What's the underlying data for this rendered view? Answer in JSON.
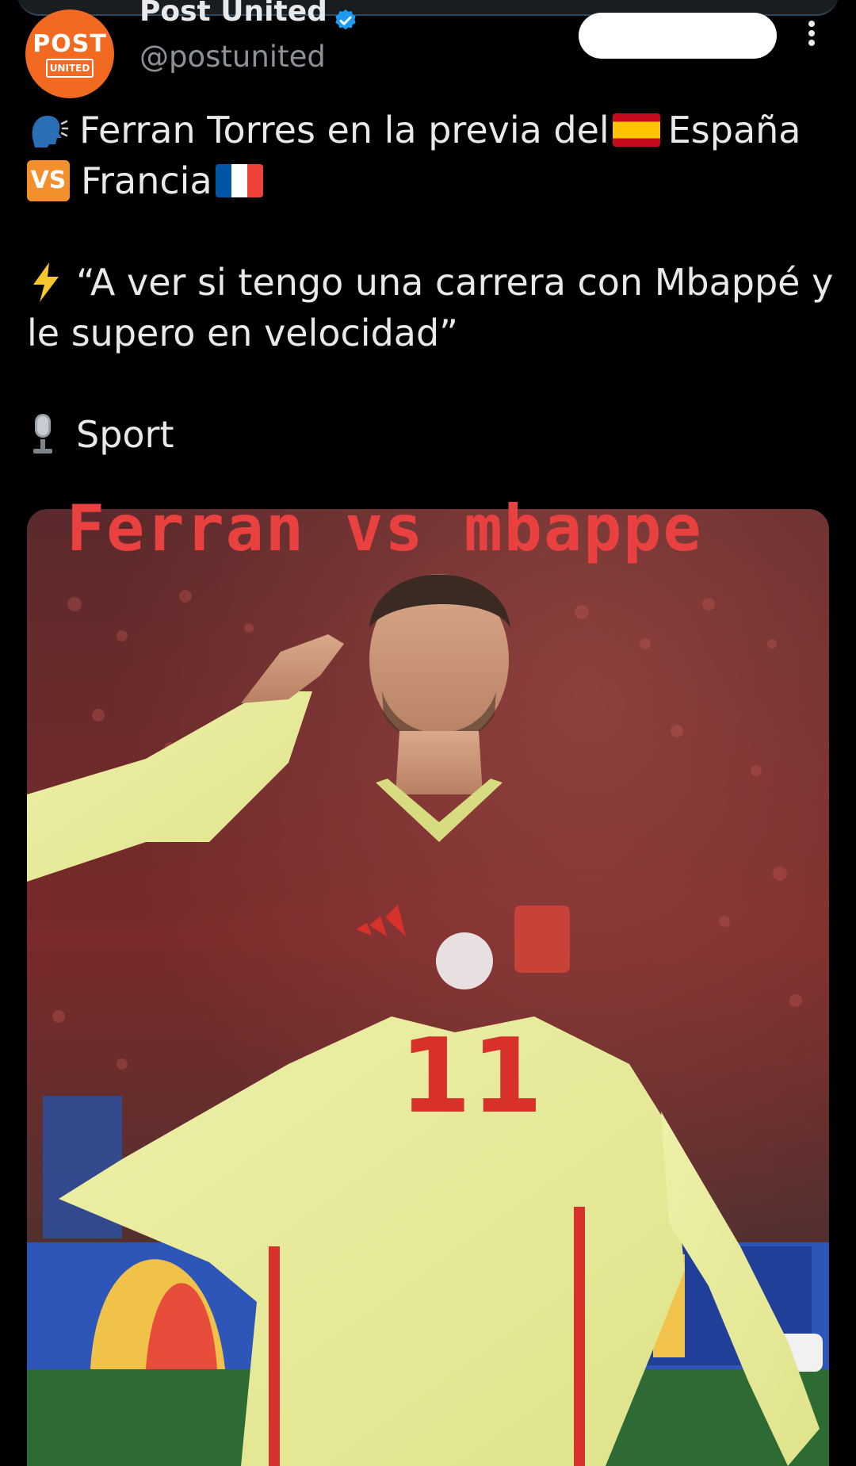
{
  "account": {
    "display_name": "Post United",
    "handle": "@postunited",
    "avatar_text": "POST",
    "avatar_subtext": "UNITED",
    "verified": true,
    "brand_color": "#f26a21"
  },
  "follow_button": {
    "label": ""
  },
  "tweet": {
    "line1": "Ferran Torres en la previa del",
    "line1_end": "España",
    "line2_badge": "VS",
    "line2": "Francia",
    "quote_line1": "“A ver si tengo una carrera con Mbappé y",
    "quote_line2": "le supero en velocidad”",
    "source": "Sport"
  },
  "media": {
    "overlay_title": "Ferran vs mbappe",
    "jersey_number": "11",
    "jersey_color": "#e9ec9a",
    "accent_red": "#e8413f"
  },
  "icons": {
    "speaking_head": "speaking-head-icon",
    "spain_flag": "spain-flag-icon",
    "france_flag": "france-flag-icon",
    "vs": "vs-icon",
    "lightning": "lightning-icon",
    "microphone": "microphone-icon",
    "verified": "verified-icon",
    "more": "more-icon"
  }
}
